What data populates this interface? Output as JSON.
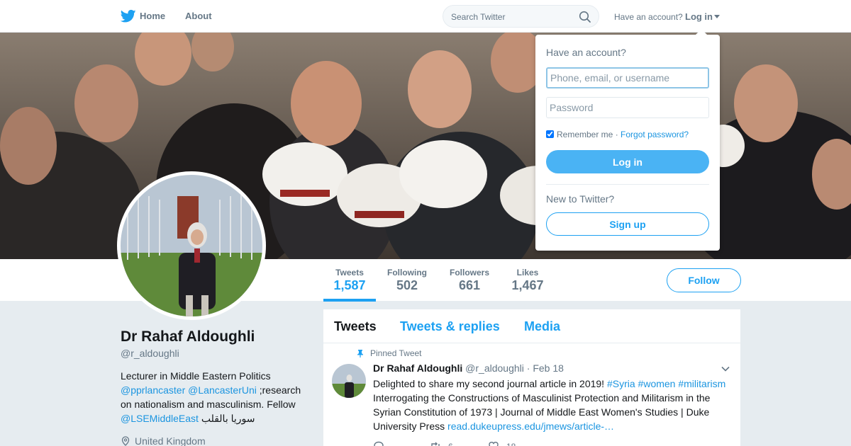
{
  "nav": {
    "home_label": "Home",
    "about_label": "About",
    "search_placeholder": "Search Twitter",
    "have_account_label": "Have an account?",
    "login_label": "Log in"
  },
  "profile": {
    "name": "Dr Rahaf Aldoughli",
    "handle": "@r_aldoughli",
    "bio_line1": "Lecturer in Middle Eastern Politics",
    "bio_mention1": "@pprlancaster",
    "bio_mention2": "@LancasterUni",
    "bio_mid": ";research on nationalism and masculinism. Fellow",
    "bio_mention3": "@LSEMiddleEast",
    "bio_arabic": "سوريا بالقلب",
    "location": "United Kingdom"
  },
  "stats": [
    {
      "label": "Tweets",
      "value": "1,587"
    },
    {
      "label": "Following",
      "value": "502"
    },
    {
      "label": "Followers",
      "value": "661"
    },
    {
      "label": "Likes",
      "value": "1,467"
    }
  ],
  "follow_label": "Follow",
  "timeline": {
    "tabs": [
      "Tweets",
      "Tweets & replies",
      "Media"
    ]
  },
  "tweet": {
    "pinned_label": "Pinned Tweet",
    "name": "Dr Rahaf Aldoughli",
    "handle": "@r_aldoughli",
    "separator": "·",
    "date": "Feb 18",
    "text_start": "Delighted to share my second journal article in 2019!",
    "hashtags": [
      "#Syria",
      "#women",
      "#militarism"
    ],
    "text_body": "Interrogating the Constructions of Masculinist Protection and Militarism in the Syrian Constitution of 1973 | Journal of Middle East Women's Studies | Duke University Press",
    "link": "read.dukeupress.edu/jmews/article-…",
    "retweets": "6",
    "likes": "18"
  },
  "login_dropdown": {
    "title": "Have an account?",
    "username_placeholder": "Phone, email, or username",
    "password_placeholder": "Password",
    "remember_label": "Remember me",
    "separator": "·",
    "forgot_label": "Forgot password?",
    "login_button": "Log in",
    "new_label": "New to Twitter?",
    "signup_button": "Sign up"
  },
  "colors": {
    "accent": "#1da1f2",
    "link": "#1b95e0",
    "muted": "#657786",
    "background": "#e6ecf0"
  }
}
